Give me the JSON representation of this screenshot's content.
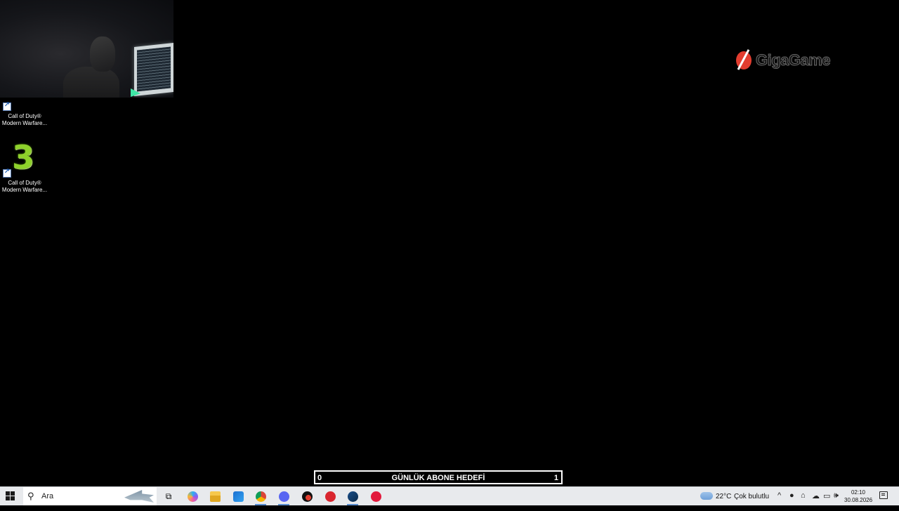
{
  "desktop": {
    "icons": [
      {
        "label_line1": "Call of Duty®",
        "label_line2": "Modern Warfare..."
      },
      {
        "label_line1": "Call of Duty®",
        "label_line2": "Modern Warfare..."
      }
    ],
    "watermark_logo": "GigaGame",
    "goal_bar": {
      "start": "0",
      "title": "GÜNLÜK ABONE HEDEFİ",
      "end": "1"
    }
  },
  "taskbar": {
    "search_placeholder": "Ara",
    "apps": [
      {
        "icon": "task-view-icon"
      },
      {
        "icon": "copilot-icon"
      },
      {
        "icon": "file-explorer-icon"
      },
      {
        "icon": "outlook-icon"
      },
      {
        "icon": "chrome-icon",
        "active": true
      },
      {
        "icon": "discord-icon",
        "active": true
      },
      {
        "icon": "app-icon"
      },
      {
        "icon": "app-red-icon"
      },
      {
        "icon": "steam-icon",
        "active": true
      },
      {
        "icon": "media-player-icon"
      }
    ],
    "tray": {
      "temperature": "22°C",
      "weather": "Çok bulutlu",
      "time": "02:10",
      "date": "30.08.2026"
    }
  },
  "colors": {
    "taskbar_bg": "#e8eaed",
    "logo_red": "#e23d2f",
    "mw3_green": "#8ed12b"
  }
}
